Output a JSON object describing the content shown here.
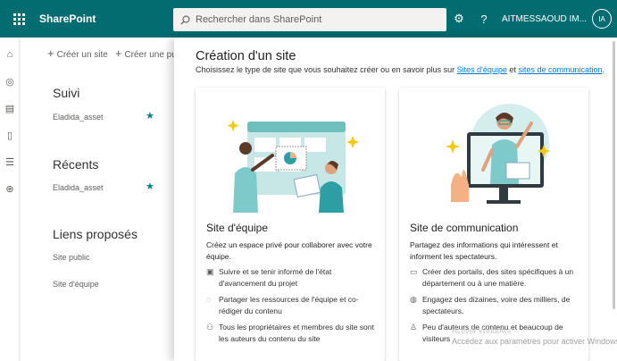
{
  "suitebar": {
    "app_name": "SharePoint",
    "search_placeholder": "Rechercher dans SharePoint",
    "user_name": "AITMESSAOUD IM...",
    "user_initials": "IA",
    "help_label": "?",
    "accent_color": "#036c70"
  },
  "commandbar": {
    "create_site": "Créer un site",
    "create_post": "Créer une publicat"
  },
  "sidebar": {
    "following_title": "Suivi",
    "following_items": [
      {
        "label": "Eladida_asset"
      }
    ],
    "recent_title": "Récents",
    "recent_items": [
      {
        "label": "Eladida_asset"
      }
    ],
    "suggested_title": "Liens proposés",
    "suggested_items": [
      {
        "label": "Site public"
      },
      {
        "label": "Site d'équipe"
      }
    ]
  },
  "panel": {
    "title": "Création d'un site",
    "subtitle_prefix": "Choisissez le type de site que vous souhaitez créer ou en savoir plus sur ",
    "link_team": "Sites d'équipe",
    "and_word": " et ",
    "link_comm": "sites de communication",
    "subtitle_suffix": "."
  },
  "cards": [
    {
      "title": "Site d'équipe",
      "description": "Créez un espace privé pour collaborer avec votre équipe.",
      "features": [
        {
          "icon": "clipboard-icon",
          "text": "Suivre et se tenir informé de l'état d'avancement du projet"
        },
        {
          "icon": "sync-icon",
          "text": "Partager les ressources de l'équipe et co-rédiger du contenu"
        },
        {
          "icon": "people-icon",
          "text": "Tous les propriétaires et membres du site sont les auteurs du contenu du site"
        }
      ]
    },
    {
      "title": "Site de communication",
      "description": "Partagez des informations qui intéressent et informent les spectateurs.",
      "features": [
        {
          "icon": "portal-icon",
          "text": "Créer des portails, des sites spécifiques à un département ou à une matière."
        },
        {
          "icon": "megaphone-icon",
          "text": "Engagez des dizaines, voire des milliers, de spectateurs."
        },
        {
          "icon": "person-icon",
          "text": "Peu d'auteurs de contenu et beaucoup de visiteurs"
        }
      ]
    }
  ],
  "watermark": {
    "line1": "Activer Windows",
    "line2": "Accédez aux paramètres pour activer Windows."
  }
}
